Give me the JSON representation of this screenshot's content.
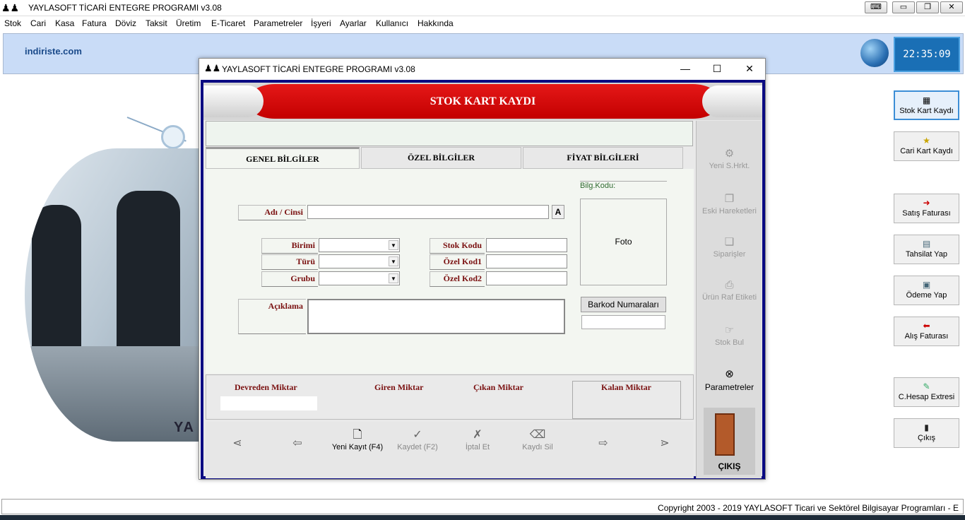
{
  "app": {
    "title": "YAYLASOFT TİCARİ ENTEGRE PROGRAMI v3.08",
    "site": "indiriste.com",
    "clock": "22:35:09",
    "copyright": "Copyright 2003 - 2019 YAYLASOFT Ticari ve Sektörel Bilgisayar Programları  -  E"
  },
  "menu": [
    "Stok",
    "Cari",
    "Kasa",
    "Fatura",
    "Döviz",
    "Taksit",
    "Üretim",
    "E-Ticaret",
    "Parametreler",
    "İşyeri",
    "Ayarlar",
    "Kullanıcı",
    "Hakkında"
  ],
  "right_buttons": [
    {
      "label": "Stok Kart Kaydı",
      "icon": "stock-card-icon"
    },
    {
      "label": "Cari Kart Kaydı",
      "icon": "person-card-icon"
    },
    {
      "label": "Satış Faturası",
      "icon": "red-arrow-right-icon"
    },
    {
      "label": "Tahsilat Yap",
      "icon": "collect-icon"
    },
    {
      "label": "Ödeme Yap",
      "icon": "payment-icon"
    },
    {
      "label": "Alış Faturası",
      "icon": "red-arrow-left-icon"
    },
    {
      "label": "C.Hesap Extresi",
      "icon": "statement-icon"
    },
    {
      "label": "Çıkış",
      "icon": "exit-door-icon"
    }
  ],
  "dialog": {
    "title": "YAYLASOFT TİCARİ ENTEGRE PROGRAMI v3.08",
    "banner": "STOK KART KAYDI",
    "tabs": [
      "GENEL BİLGİLER",
      "ÖZEL BİLGİLER",
      "FİYAT BİLGİLERİ"
    ],
    "fields": {
      "adi_cinsi": "Adı / Cinsi",
      "a_button": "A",
      "birimi": "Birimi",
      "turu": "Türü",
      "grubu": "Grubu",
      "stok_kodu": "Stok Kodu",
      "ozel_kod1": "Özel Kod1",
      "ozel_kod2": "Özel Kod2",
      "aciklama": "Açıklama",
      "bilg_kodu": "Bilg.Kodu:",
      "foto": "Foto",
      "barkod": "Barkod Numaraları"
    },
    "quantities": {
      "devreden": "Devreden Miktar",
      "giren": "Giren Miktar",
      "cikan": "Çıkan Miktar",
      "kalan": "Kalan Miktar"
    },
    "bottom_buttons": {
      "yeni_kayit": "Yeni Kayıt (F4)",
      "kaydet": "Kaydet (F2)",
      "iptal": "İptal Et",
      "kaydi_sil": "Kaydı Sil"
    },
    "side_buttons": [
      "Yeni S.Hrkt.",
      "Eski Hareketleri",
      "Siparişler",
      "Ürün Raf Etiketi",
      "Stok Bul",
      "Parametreler"
    ],
    "exit": "ÇIKIŞ"
  }
}
